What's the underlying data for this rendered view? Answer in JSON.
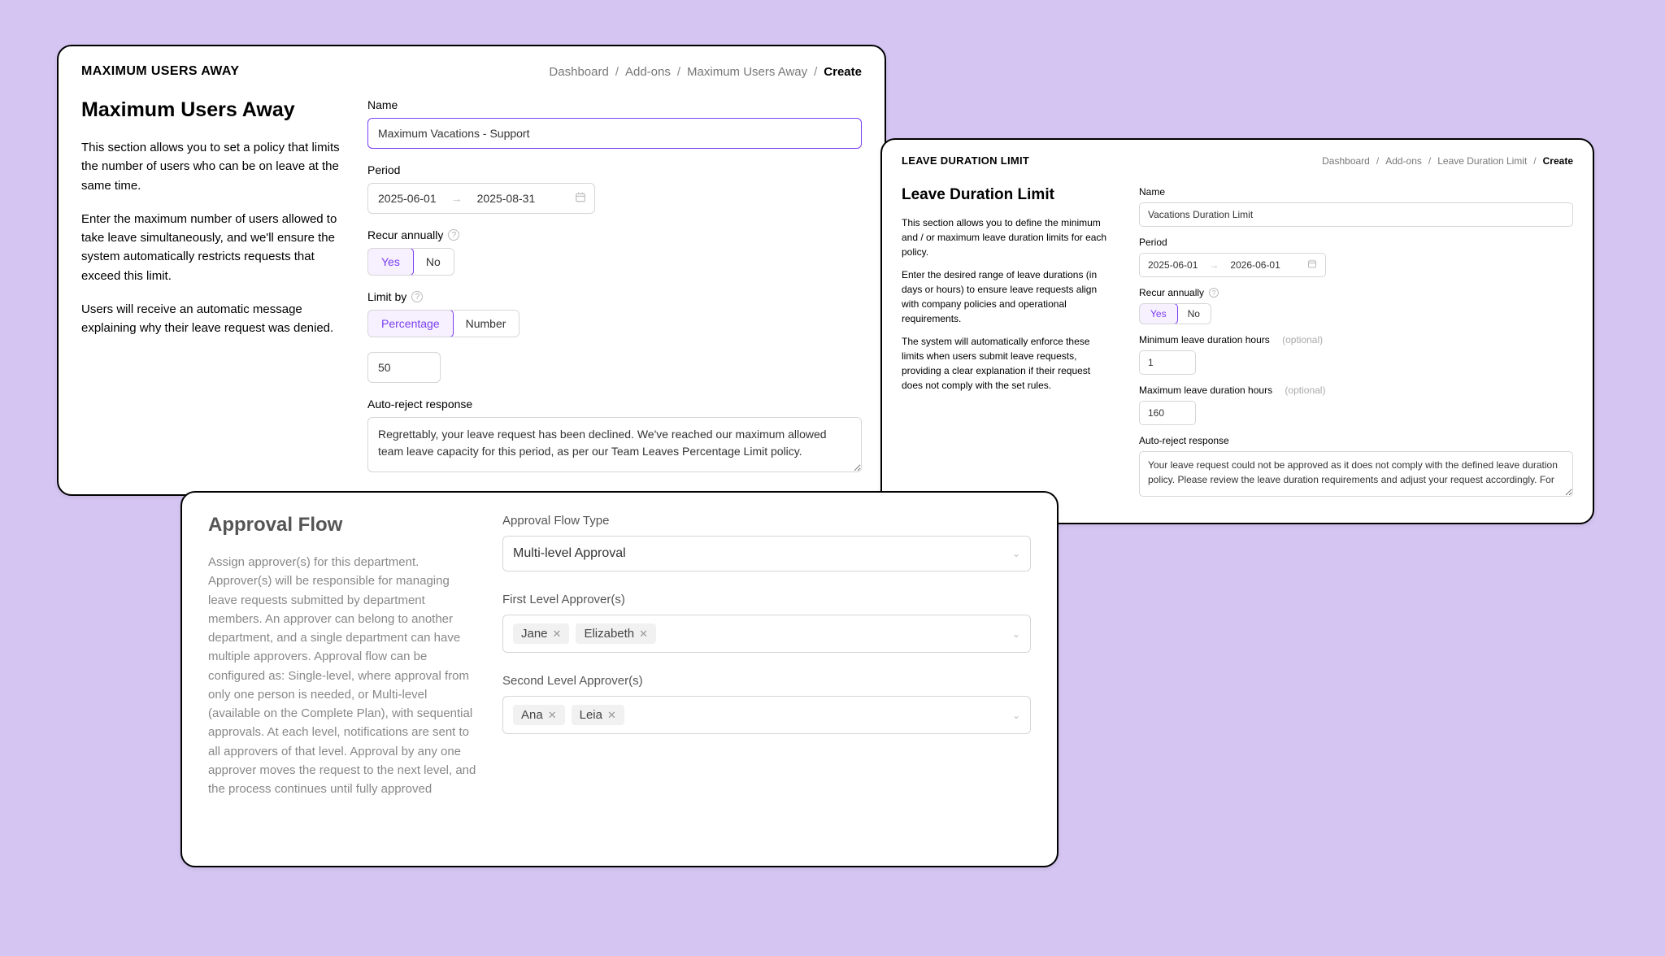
{
  "mua": {
    "header": "MAXIMUM USERS AWAY",
    "breadcrumb": [
      "Dashboard",
      "Add-ons",
      "Maximum Users Away",
      "Create"
    ],
    "title": "Maximum Users Away",
    "p1": "This section allows you to set a policy that limits the number of users who can be on leave at the same time.",
    "p2": "Enter the maximum number of users allowed to take leave simultaneously, and we'll ensure the system automatically restricts requests that exceed this limit.",
    "p3": "Users will receive an automatic message explaining why their leave request was denied.",
    "name_label": "Name",
    "name_value": "Maximum Vacations - Support",
    "period_label": "Period",
    "period_start": "2025-06-01",
    "period_end": "2025-08-31",
    "recur_label": "Recur annually",
    "yes": "Yes",
    "no": "No",
    "limit_label": "Limit by",
    "limit_percentage": "Percentage",
    "limit_number": "Number",
    "limit_value": "50",
    "autoreject_label": "Auto-reject response",
    "autoreject_value": "Regrettably, your leave request has been declined. We've reached our maximum allowed team leave capacity for this period, as per our Team Leaves Percentage Limit policy."
  },
  "ldl": {
    "header": "LEAVE DURATION LIMIT",
    "breadcrumb": [
      "Dashboard",
      "Add-ons",
      "Leave Duration Limit",
      "Create"
    ],
    "title": "Leave Duration Limit",
    "p1": "This section allows you to define the minimum and / or maximum leave duration limits for each policy.",
    "p2": "Enter the desired range of leave durations (in days or hours) to ensure leave requests align with company policies and operational requirements.",
    "p3": "The system will automatically enforce these limits when users submit leave requests, providing a clear explanation if their request does not comply with the set rules.",
    "name_label": "Name",
    "name_value": "Vacations Duration Limit",
    "period_label": "Period",
    "period_start": "2025-06-01",
    "period_end": "2026-06-01",
    "recur_label": "Recur annually",
    "yes": "Yes",
    "no": "No",
    "min_label": "Minimum leave duration hours",
    "optional": "(optional)",
    "min_value": "1",
    "max_label": "Maximum leave duration hours",
    "max_value": "160",
    "autoreject_label": "Auto-reject response",
    "autoreject_value": "Your leave request could not be approved as it does not comply with the defined leave duration policy. Please review the leave duration requirements and adjust your request accordingly. For"
  },
  "af": {
    "title": "Approval Flow",
    "desc": "Assign approver(s) for this department. Approver(s) will be responsible for managing leave requests submitted by department members. An approver can belong to another department, and a single department can have multiple approvers. Approval flow can be configured as: Single-level, where approval from only one person is needed, or Multi-level (available on the Complete Plan), with sequential approvals. At each level, notifications are sent to all approvers of that level. Approval by any one approver moves the request to the next level, and the process continues until fully approved",
    "type_label": "Approval Flow Type",
    "type_value": "Multi-level Approval",
    "l1_label": "First Level Approver(s)",
    "l1_tags": [
      "Jane",
      "Elizabeth"
    ],
    "l2_label": "Second Level Approver(s)",
    "l2_tags": [
      "Ana",
      "Leia"
    ]
  }
}
